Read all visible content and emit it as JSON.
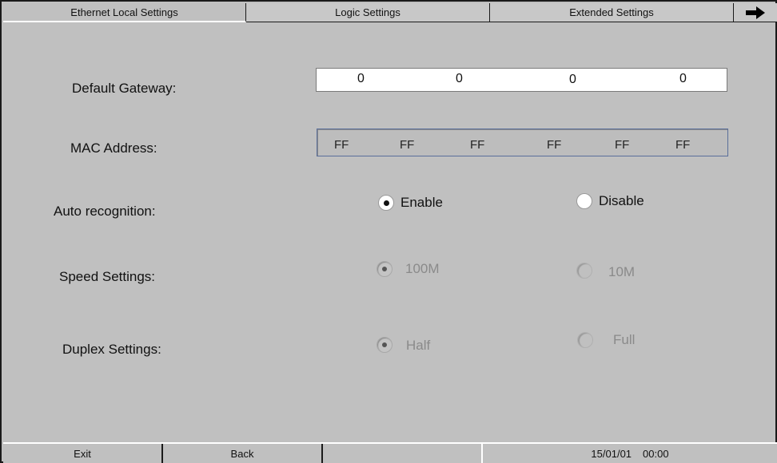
{
  "tabs": {
    "ethernet_local": "Ethernet Local Settings",
    "logic": "Logic Settings",
    "extended": "Extended Settings",
    "next_icon": "right-arrow-icon"
  },
  "labels": {
    "gateway": "Default Gateway:",
    "mac": "MAC Address:",
    "auto": "Auto recognition:",
    "speed": "Speed Settings:",
    "duplex": "Duplex Settings:"
  },
  "gateway": [
    "0",
    "0",
    "0",
    "0"
  ],
  "mac": [
    "FF",
    "FF",
    "FF",
    "FF",
    "FF",
    "FF"
  ],
  "auto_recognition": {
    "enable": "Enable",
    "disable": "Disable",
    "selected": "enable"
  },
  "speed": {
    "opt1": "100M",
    "opt2": "10M",
    "selected": "100M",
    "disabled": true
  },
  "duplex": {
    "opt1": "Half",
    "opt2": "Full",
    "selected": "Half",
    "disabled": true
  },
  "bottom": {
    "exit": "Exit",
    "back": "Back",
    "date": "15/01/01",
    "time": "00:00"
  }
}
